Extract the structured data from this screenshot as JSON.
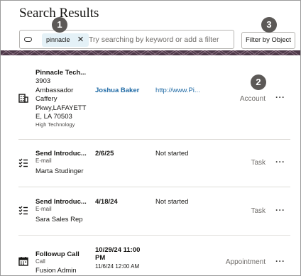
{
  "header": {
    "title": "Search Results"
  },
  "search": {
    "chip_label": "pinnacle",
    "placeholder": "Try searching by keyword or add a filter"
  },
  "filter_button": {
    "label": "Filter by Object"
  },
  "badges": [
    "1",
    "2",
    "3"
  ],
  "colors": {
    "link": "#1f6aa5",
    "badge": "#5c5957",
    "chip_bg": "#e4f1f7",
    "banner": "#4f3a4a"
  },
  "results": [
    {
      "icon": "building-icon",
      "name": "Pinnacle Tech...",
      "address_lines": [
        "3903",
        "Ambassador",
        "Caffery",
        "Pkwy,LAFAYETT",
        "E, LA 70503"
      ],
      "industry": "High Technology",
      "contact": "Joshua Baker",
      "website": "http://www.Pi...",
      "type": "Account"
    },
    {
      "icon": "task-list-icon",
      "name": "Send Introduc...",
      "subtype": "E-mail",
      "person": "Marta Studinger",
      "date": "2/6/25",
      "status": "Not started",
      "type": "Task"
    },
    {
      "icon": "task-list-icon",
      "name": "Send Introduc...",
      "subtype": "E-mail",
      "person": "Sara Sales Rep",
      "date": "4/18/24",
      "status": "Not started",
      "type": "Task"
    },
    {
      "icon": "calendar-icon",
      "name": "Followup Call",
      "subtype": "Call",
      "person": "Fusion Admin",
      "start_line1": "10/29/24 11:00",
      "start_line2": "PM",
      "end": "11/6/24 12:00 AM",
      "type": "Appointment"
    }
  ],
  "more_label": "···"
}
